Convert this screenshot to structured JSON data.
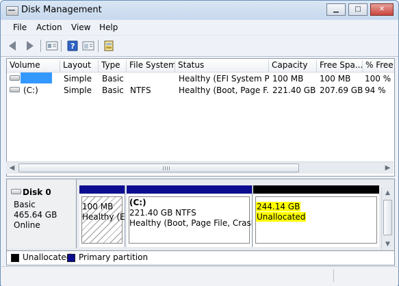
{
  "window": {
    "title": "Disk Management",
    "controls": {
      "minimize": "▁",
      "maximize": "□",
      "close": "✕"
    }
  },
  "menu": [
    "File",
    "Action",
    "View",
    "Help"
  ],
  "toolbar": {
    "icons": [
      "back-arrow-icon",
      "forward-arrow-icon",
      "properties-icon",
      "help-icon",
      "show-pane-icon",
      "disk-settings-icon"
    ]
  },
  "table": {
    "columns": [
      "Volume",
      "Layout",
      "Type",
      "File System",
      "Status",
      "Capacity",
      "Free Spa...",
      "% Free"
    ],
    "rows": [
      {
        "volume": "",
        "layout": "Simple",
        "type": "Basic",
        "fs": "",
        "status": "Healthy (EFI System P...",
        "capacity": "100 MB",
        "free": "100 MB",
        "pct": "100 %"
      },
      {
        "volume": "(C:)",
        "layout": "Simple",
        "type": "Basic",
        "fs": "NTFS",
        "status": "Healthy (Boot, Page F...",
        "capacity": "221.40 GB",
        "free": "207.69 GB",
        "pct": "94 %"
      }
    ]
  },
  "disk": {
    "name": "Disk 0",
    "type": "Basic",
    "size": "465.64 GB",
    "state": "Online",
    "partitions": [
      {
        "size": "100 MB",
        "status": "Healthy (E"
      },
      {
        "title": "(C:)",
        "size": "221.40 GB NTFS",
        "status": "Healthy (Boot, Page File, Crash D"
      },
      {
        "size": "244.14 GB",
        "status": "Unallocated"
      }
    ]
  },
  "legend": [
    "Unallocated",
    "Primary partition"
  ],
  "colors": {
    "primary": "#0c0c90",
    "unallocated": "#000000",
    "highlight": "#ffff00",
    "selection": "#3399ff"
  }
}
